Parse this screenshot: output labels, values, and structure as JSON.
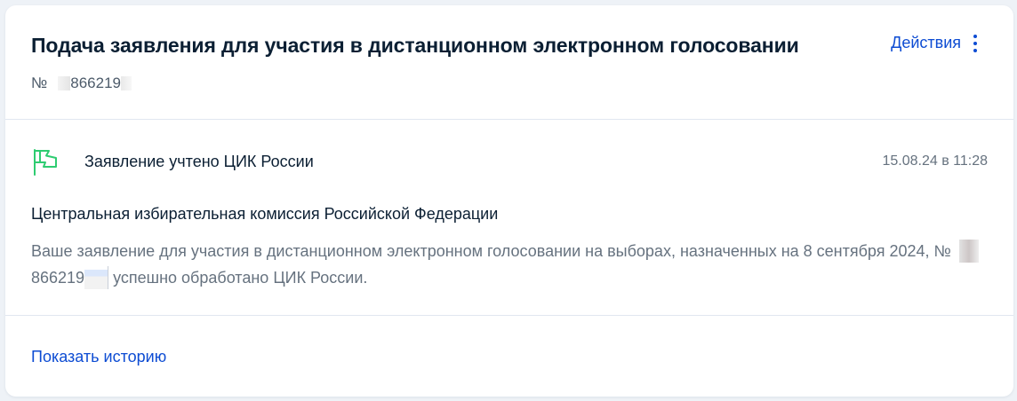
{
  "card": {
    "title": "Подача заявления для участия в дистанционном электронном голосовании",
    "number_prefix": "№",
    "number_visible": "866219",
    "actions_label": "Действия"
  },
  "status": {
    "icon": "flag-icon",
    "text": "Заявление учтено ЦИК России",
    "date": "15.08.24 в 11:28"
  },
  "details": {
    "organization": "Центральная избирательная комиссия Российской Федерации",
    "message_part1": "Ваше заявление для участия в дистанционном электронном голосовании на выборах, назначенных на 8 сентября 2024, №",
    "message_number": "866219",
    "message_part2": "успешно обработано ЦИК России."
  },
  "footer": {
    "history_link": "Показать историю"
  },
  "colors": {
    "accent": "#0d4cd3",
    "success": "#2ecc71",
    "text_primary": "#0b1f33",
    "text_secondary": "#66727f",
    "background": "#eef2f7"
  }
}
